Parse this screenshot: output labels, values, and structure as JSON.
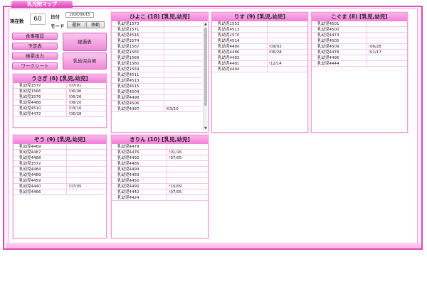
{
  "app": {
    "title": "乳児院マップ"
  },
  "header": {
    "present_label": "現在数",
    "present_count": "60",
    "date_label": "日付",
    "date_value": "2020/09/15",
    "mode_label": "モード",
    "mode_select": "選択",
    "mode_move": "移動"
  },
  "buttons": {
    "meal": "食事確認",
    "schedule": "予定表",
    "forms": "帳票出力",
    "worksheet": "ワークシート",
    "progress": "経過表",
    "register": "乳幼児台帳"
  },
  "panels": [
    {
      "id": "usagi",
      "title": "うさぎ (6) [乳児,幼児]",
      "rows": [
        {
          "name": "乳幼児1577",
          "mark": "!",
          "date": "07/01"
        },
        {
          "name": "乳幼児1566",
          "mark": "!",
          "date": "06/06"
        },
        {
          "name": "乳幼児1576",
          "mark": "!",
          "date": "06/26"
        },
        {
          "name": "乳幼児4488",
          "mark": "!",
          "date": "08/20"
        },
        {
          "name": "乳幼児4510",
          "mark": "!",
          "date": "03/16"
        },
        {
          "name": "乳幼児4472",
          "mark": "!",
          "date": "06/28"
        }
      ]
    },
    {
      "id": "hiyoko",
      "title": "ひよこ (18) [乳児,幼児]",
      "rows": [
        {
          "name": "乳幼児1573",
          "mark": "",
          "date": ""
        },
        {
          "name": "乳幼児1571",
          "mark": "",
          "date": ""
        },
        {
          "name": "乳幼児4516",
          "mark": "",
          "date": ""
        },
        {
          "name": "乳幼児1574",
          "mark": "",
          "date": ""
        },
        {
          "name": "乳幼児1567",
          "mark": "",
          "date": ""
        },
        {
          "name": "乳幼児1565",
          "mark": "",
          "date": ""
        },
        {
          "name": "乳幼児1569",
          "mark": "",
          "date": ""
        },
        {
          "name": "乳幼児1560",
          "mark": "",
          "date": ""
        },
        {
          "name": "乳幼児1559",
          "mark": "",
          "date": ""
        },
        {
          "name": "乳幼児4511",
          "mark": "",
          "date": ""
        },
        {
          "name": "乳幼児4513",
          "mark": "",
          "date": ""
        },
        {
          "name": "乳幼児4515",
          "mark": "",
          "date": ""
        },
        {
          "name": "乳幼児4504",
          "mark": "",
          "date": ""
        },
        {
          "name": "乳幼児4498",
          "mark": "",
          "date": ""
        },
        {
          "name": "乳幼児4506",
          "mark": "",
          "date": ""
        },
        {
          "name": "乳幼児4497",
          "mark": "!",
          "date": "03/10"
        }
      ]
    },
    {
      "id": "risu",
      "title": "りす (9) [乳児,幼児]",
      "rows": [
        {
          "name": "乳幼児1553",
          "mark": "",
          "date": ""
        },
        {
          "name": "乳幼児4512",
          "mark": "",
          "date": ""
        },
        {
          "name": "乳幼児1570",
          "mark": "",
          "date": ""
        },
        {
          "name": "乳幼児4514",
          "mark": "",
          "date": ""
        },
        {
          "name": "乳幼児4480",
          "mark": "!",
          "date": "09/02"
        },
        {
          "name": "乳幼児4486",
          "mark": "!",
          "date": "06/28"
        },
        {
          "name": "乳幼児4482",
          "mark": "",
          "date": ""
        },
        {
          "name": "乳幼児4481",
          "mark": "!",
          "date": "12/14"
        },
        {
          "name": "乳幼児4494",
          "mark": "",
          "date": ""
        }
      ]
    },
    {
      "id": "koguma",
      "title": "こぐま (8) [乳児,幼児]",
      "rows": [
        {
          "name": "乳幼児4501",
          "mark": "",
          "date": ""
        },
        {
          "name": "乳幼児4500",
          "mark": "",
          "date": ""
        },
        {
          "name": "乳幼児4473",
          "mark": "",
          "date": ""
        },
        {
          "name": "乳幼児4505",
          "mark": "",
          "date": ""
        },
        {
          "name": "乳幼児4509",
          "mark": "!",
          "date": "06/28"
        },
        {
          "name": "乳幼児4478",
          "mark": "!",
          "date": "01/17"
        },
        {
          "name": "乳幼児4496",
          "mark": "",
          "date": ""
        },
        {
          "name": "乳幼児4444",
          "mark": "",
          "date": ""
        }
      ]
    },
    {
      "id": "zou",
      "title": "ぞう (9) [乳児,幼児]",
      "rows": [
        {
          "name": "乳幼児4469",
          "mark": "",
          "date": ""
        },
        {
          "name": "乳幼児4487",
          "mark": "",
          "date": ""
        },
        {
          "name": "乳幼児4468",
          "mark": "",
          "date": ""
        },
        {
          "name": "乳幼児1572",
          "mark": "",
          "date": ""
        },
        {
          "name": "乳幼児4484",
          "mark": "",
          "date": ""
        },
        {
          "name": "乳幼児4489",
          "mark": "",
          "date": ""
        },
        {
          "name": "乳幼児4459",
          "mark": "",
          "date": ""
        },
        {
          "name": "乳幼児4440",
          "mark": "!",
          "date": "07/05"
        },
        {
          "name": "乳幼児4466",
          "mark": "",
          "date": ""
        }
      ]
    },
    {
      "id": "kirin",
      "title": "きりん (10) [乳児,幼児]",
      "rows": [
        {
          "name": "乳幼児4479",
          "mark": "",
          "date": ""
        },
        {
          "name": "乳幼児4476",
          "mark": "!",
          "date": "01/16"
        },
        {
          "name": "乳幼児4492",
          "mark": "!",
          "date": "07/05"
        },
        {
          "name": "乳幼児4485",
          "mark": "",
          "date": ""
        },
        {
          "name": "乳幼児4499",
          "mark": "",
          "date": ""
        },
        {
          "name": "乳幼児4483",
          "mark": "",
          "date": ""
        },
        {
          "name": "乳幼児4450",
          "mark": "",
          "date": ""
        },
        {
          "name": "乳幼児4490",
          "mark": "!",
          "date": "10/09"
        },
        {
          "name": "乳幼児4442",
          "mark": "!",
          "date": "07/05"
        },
        {
          "name": "乳幼児4424",
          "mark": "",
          "date": ""
        }
      ]
    }
  ]
}
